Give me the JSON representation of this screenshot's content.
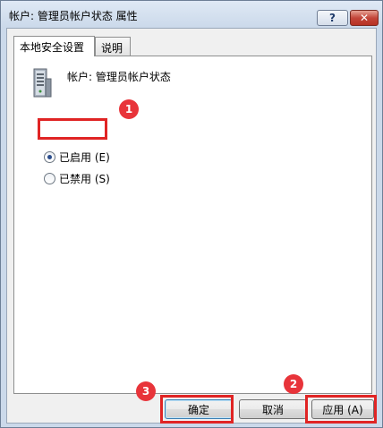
{
  "window": {
    "title": "帐户: 管理员帐户状态 属性"
  },
  "titlebar": {
    "help_glyph": "?",
    "close_glyph": "✕"
  },
  "tabs": [
    {
      "label": "本地安全设置",
      "active": true
    },
    {
      "label": "说明",
      "active": false
    }
  ],
  "panel": {
    "heading": "帐户: 管理员帐户状态",
    "icon": "server-icon",
    "options": [
      {
        "label": "已启用 (E)",
        "checked": true
      },
      {
        "label": "已禁用 (S)",
        "checked": false
      }
    ]
  },
  "buttons": {
    "ok": "确定",
    "cancel": "取消",
    "apply": "应用 (A)"
  },
  "annotations": {
    "badge1": "1",
    "badge2": "2",
    "badge3": "3",
    "color": "#e02424"
  }
}
